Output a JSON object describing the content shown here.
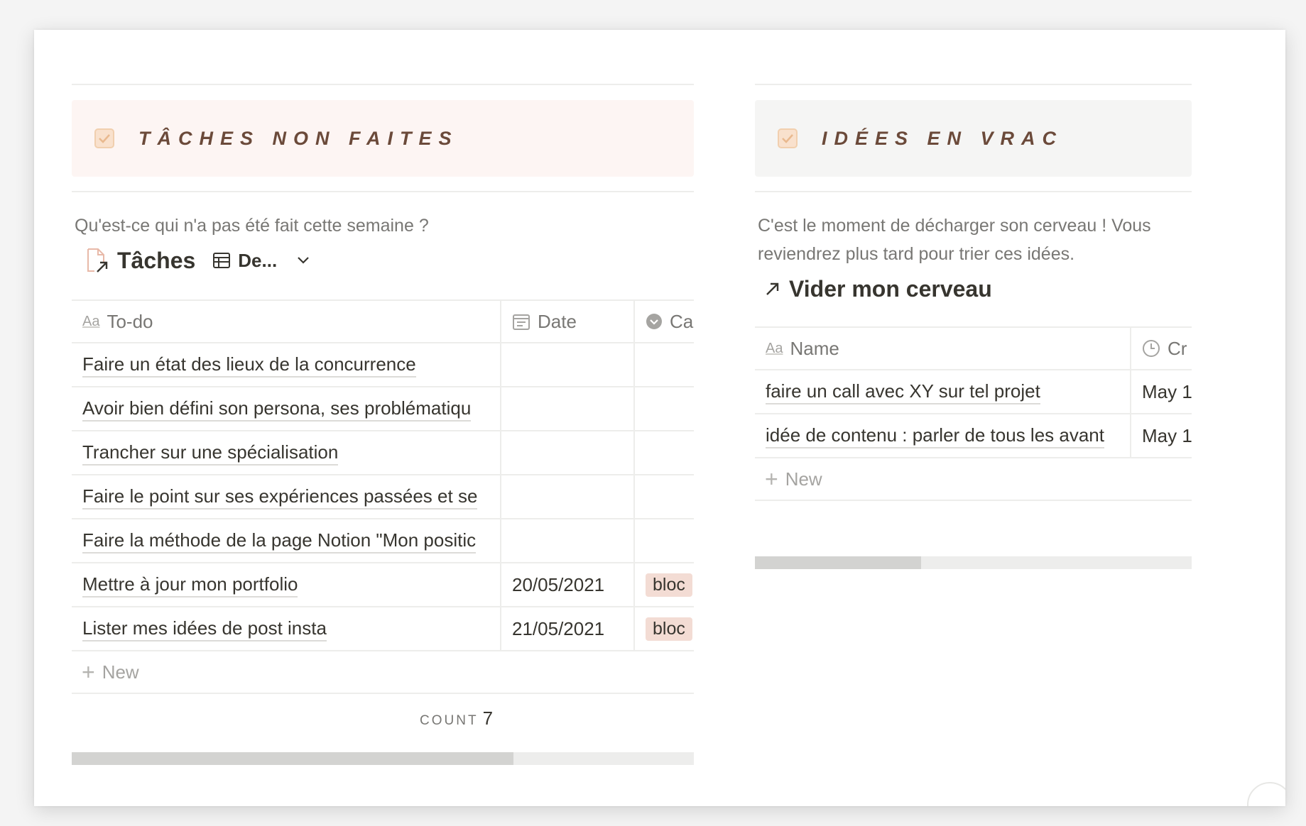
{
  "left": {
    "callout_title": "TÂCHES NON FAITES",
    "description": "Qu'est-ce qui n'a pas été fait cette semaine ?",
    "database": {
      "title": "Tâches",
      "view_label": "De...",
      "columns": [
        "To-do",
        "Date",
        "Ca"
      ],
      "rows": [
        {
          "todo": "Faire un état des lieux de la concurrence",
          "date": "",
          "tag": ""
        },
        {
          "todo": "Avoir bien défini son persona, ses problématiqu",
          "date": "",
          "tag": ""
        },
        {
          "todo": "Trancher sur une spécialisation",
          "date": "",
          "tag": ""
        },
        {
          "todo": "Faire le point sur ses expériences passées et se",
          "date": "",
          "tag": ""
        },
        {
          "todo": "Faire la méthode de la page Notion \"Mon positic",
          "date": "",
          "tag": ""
        },
        {
          "todo": "Mettre à jour mon portfolio",
          "date": "20/05/2021",
          "tag": "bloc"
        },
        {
          "todo": "Lister mes idées de post insta",
          "date": "21/05/2021",
          "tag": "bloc"
        }
      ],
      "new_label": "New",
      "count_label": "COUNT",
      "count_value": "7",
      "scroll_fraction": 0.71
    }
  },
  "right": {
    "callout_title": "IDÉES EN VRAC",
    "description": "C'est le moment de décharger son cerveau ! Vous reviendrez plus tard pour trier ces idées.",
    "database": {
      "title": "Vider mon cerveau",
      "columns": [
        "Name",
        "Cr"
      ],
      "rows": [
        {
          "name": "faire un call avec XY sur tel projet",
          "created": "May 1"
        },
        {
          "name": "idée de contenu : parler de tous les avant",
          "created": "May 1"
        }
      ],
      "new_label": "New",
      "scroll_fraction": 0.38
    }
  },
  "colors": {
    "callout_pink": "#fdf5f3",
    "callout_grey": "#f5f5f4",
    "tag_bg": "#f3dcd4",
    "heading_brown": "#6b4a3a"
  }
}
